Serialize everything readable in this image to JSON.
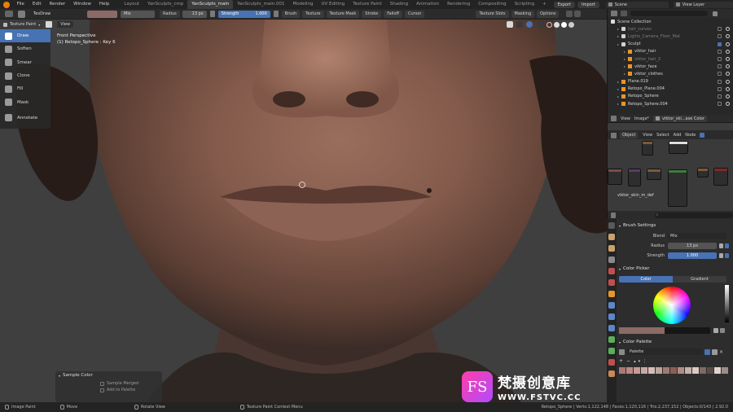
{
  "topbar": {
    "menus": [
      "File",
      "Edit",
      "Render",
      "Window",
      "Help"
    ],
    "workspaces": [
      "Layout",
      "YanSculpts_cmp",
      "YanSculpts_main",
      "YanSculpts_main.001",
      "Modeling",
      "UV Editing",
      "Texture Paint",
      "Shading",
      "Animation",
      "Rendering",
      "Compositing",
      "Scripting"
    ],
    "active_workspace": "YanSculpts_main",
    "export_label": "Export",
    "import_label": "Import",
    "scene": "Scene",
    "view_layer": "View Layer"
  },
  "toolheader": {
    "brush_name": "TexDraw",
    "blend": "Mix",
    "radius_label": "Radius",
    "radius_value": "13 px",
    "strength_label": "Strength",
    "strength_value": "1.000",
    "menus": [
      "Brush",
      "Texture",
      "Texture Mask",
      "Stroke",
      "Falloff",
      "Cursor"
    ],
    "right_menus": [
      "Texture Slots",
      "Masking",
      "Options"
    ]
  },
  "mode": {
    "label": "Texture Paint",
    "view": "View"
  },
  "tools": [
    {
      "label": "Draw",
      "active": true
    },
    {
      "label": "Soften",
      "active": false
    },
    {
      "label": "Smear",
      "active": false
    },
    {
      "label": "Clone",
      "active": false
    },
    {
      "label": "Fill",
      "active": false
    },
    {
      "label": "Mask",
      "active": false
    },
    {
      "label": "Annotate",
      "active": false
    }
  ],
  "overlay": {
    "line1": "Front Perspective",
    "line2": "(1) Retopo_Sphere : Key 6"
  },
  "sample_panel": {
    "title": "Sample Color",
    "option1": "Sample Merged",
    "option2": "Add to Palette"
  },
  "statusbar": {
    "item1": "Image Paint",
    "item2": "Move",
    "item3": "Rotate View",
    "item4": "Texture Paint Context Menu",
    "stats": "Retopo_Sphere | Verts:1,122,148 | Faces:1,120,116 | Tris:2,237,152 | Objects:0/143 | 2.92.0"
  },
  "outliner": {
    "root": "Scene Collection",
    "rows": [
      {
        "name": "hair_curves",
        "dim": true,
        "icon": "collection",
        "indent": 1
      },
      {
        "name": "Lights_Camera_Floor_Mat",
        "dim": true,
        "icon": "collection",
        "indent": 1
      },
      {
        "name": "Sculpt",
        "dim": false,
        "icon": "collection",
        "indent": 1
      },
      {
        "name": "viktor_hair",
        "dim": false,
        "icon": "mesh",
        "indent": 2
      },
      {
        "name": "viktor_hair_2",
        "dim": true,
        "icon": "mesh",
        "indent": 2
      },
      {
        "name": "viktor_face",
        "dim": false,
        "icon": "mesh",
        "indent": 2
      },
      {
        "name": "viktor_clothes",
        "dim": false,
        "icon": "mesh",
        "indent": 2
      },
      {
        "name": "Plane.019",
        "dim": false,
        "icon": "mesh",
        "indent": 1
      },
      {
        "name": "Retopo_Plane.004",
        "dim": false,
        "icon": "mesh",
        "indent": 1
      },
      {
        "name": "Retopo_Sphere",
        "dim": false,
        "icon": "mesh",
        "indent": 1
      },
      {
        "name": "Retopo_Sphere.004",
        "dim": false,
        "icon": "mesh",
        "indent": 1
      }
    ]
  },
  "image_editor": {
    "view": "View",
    "image": "Image*",
    "image_name": "viktor_ski...ase Color"
  },
  "node_editor": {
    "object": "Object",
    "menus": [
      "View",
      "Select",
      "Add",
      "Node"
    ],
    "node_label": "viktor_skin_m_def"
  },
  "properties": {
    "brush_settings": "Brush Settings",
    "blend_label": "Blend",
    "blend_value": "Mix",
    "radius_label": "Radius",
    "radius_value": "13 px",
    "strength_label": "Strength",
    "strength_value": "1.000",
    "color_picker": "Color Picker",
    "color_tab": "Color",
    "gradient_tab": "Gradient",
    "color_palette": "Color Palette",
    "palette_name": "Palette"
  },
  "palette_colors": [
    "#a87a73",
    "#b98a86",
    "#c69a96",
    "#caa9a3",
    "#d5bdb6",
    "#bfa49c",
    "#9e7b72",
    "#876058",
    "#b08d84",
    "#c8b0aa",
    "#dccac4",
    "#7d6a65",
    "#5b4a45",
    "#e0d4cf",
    "#9d8c87"
  ],
  "colors": {
    "accent": "#4772b3",
    "primary_color": "#8c6a66",
    "secondary_color": "#161616"
  },
  "watermark": {
    "logo_letters": "FS",
    "cn_text": "梵摄创意库",
    "url": "WWW.FSTVC.CC"
  }
}
